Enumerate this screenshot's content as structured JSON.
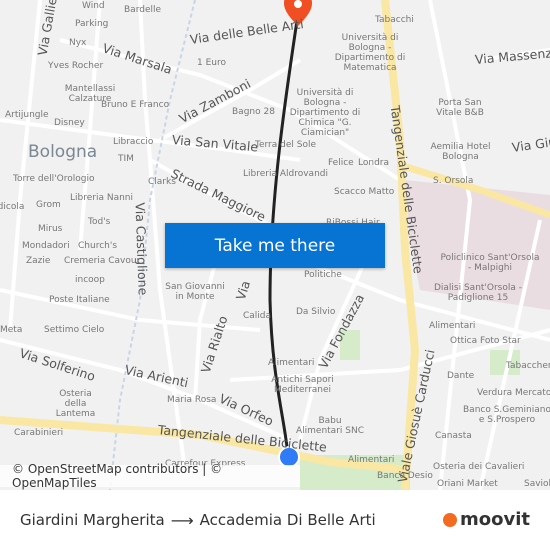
{
  "colors": {
    "route": "#222222",
    "cta": "#0773d3",
    "destination_pin": "#f04e23",
    "origin_dot": "#2f7cf6",
    "ring_road": "#f9e7a3",
    "hospital_area": "#eadde2",
    "park": "#d5ebc9",
    "moovit": "#f36b21"
  },
  "map": {
    "city": "Bologna",
    "streets": [
      "Via Marsala",
      "Via delle Belle Arti",
      "Via Zamboni",
      "Via San Vitale",
      "Strada Maggiore",
      "Via Castiglione",
      "Tangenziale delle Biciclette",
      "Via Massenzio",
      "Via Giuseppe",
      "Via Solferino",
      "Via Arienti",
      "Via Rialto",
      "Via Orfeo",
      "Via Fondazza",
      "Viale Giosuè Carducci",
      "Tangenziale delle Biciclette",
      "Via Galliera",
      "Via"
    ],
    "labels": [
      "Wind",
      "Bardelle",
      "Parking",
      "Nyx",
      "Yves Rocher",
      "Mantellassi Calzature",
      "Bruno E Franco",
      "Artijungle",
      "Disney",
      "Libraccio",
      "TIM",
      "Torre dell'Orologio",
      "Clarks",
      "Libreria Nanni",
      "Grom",
      "Edicola",
      "Tod's",
      "Mirus",
      "Mondadori",
      "Church's",
      "Zazie",
      "Cremeria Cavour",
      "incoop",
      "Poste Italiane",
      "Settimo Cielo",
      "Meta",
      "Osteria della Lantema",
      "Carabinieri",
      "Maria Rosa",
      "San Giovanni in Monte",
      "Calida",
      "1 Euro",
      "Bagno 28",
      "Terra del Sole",
      "Libreria Aldrovandi",
      "Università di Bologna - Dipartimento di Chimica \"G. Ciamician\"",
      "Tabacchi",
      "Università di Bologna - Dipartimento di Matematica",
      "Felice",
      "Londra",
      "Scacco Matto",
      "RiBossi Hair",
      "Porta San Vitale B&B",
      "Aemilia Hotel Bologna",
      "S. Orsola",
      "Politiche",
      "Policlinico Sant'Orsola - Malpighi",
      "Dialisi Sant'Orsola - Padiglione 15",
      "Da Silvio",
      "Alimentari",
      "Ottica Foto Star",
      "Alimentari",
      "Antichi Sapori Mediterranei",
      "Dante",
      "Tabaccheria",
      "Verdura Mercato",
      "Banco S.Geminiano e S.Prospero",
      "Babu Alimentari SNC",
      "Canasta",
      "Alimentari",
      "Banco Desio",
      "Osteria dei Cavalieri",
      "Oriani Market",
      "Saviol",
      "Carrefour Express"
    ]
  },
  "cta_label": "Take me there",
  "attribution": "© OpenStreetMap contributors | © OpenMapTiles",
  "footer": {
    "from": "Giardini Margherita",
    "to": "Accademia Di Belle Arti",
    "arrow_icon": "arrow-right-icon",
    "logo_text": "moovit"
  }
}
